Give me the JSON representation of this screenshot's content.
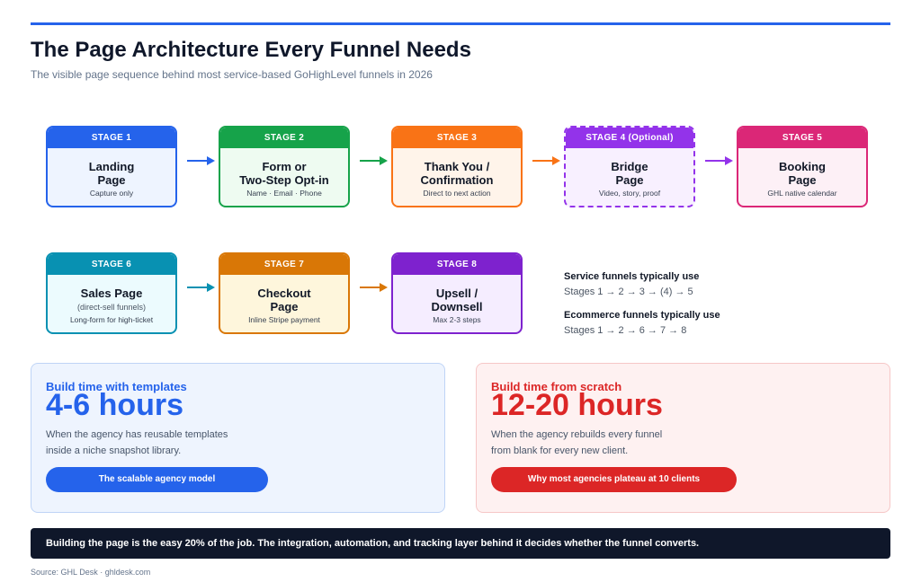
{
  "header": {
    "title": "The Page Architecture Every Funnel Needs",
    "subtitle": "The visible page sequence behind most service-based GoHighLevel funnels in 2026"
  },
  "stages": [
    {
      "label": "STAGE 1",
      "name": "Landing\nPage",
      "sub": "",
      "desc": "Capture only",
      "color": "#2563eb",
      "bg": "#eef4ff",
      "dashed": false
    },
    {
      "label": "STAGE 2",
      "name": "Form or\nTwo-Step Opt-in",
      "sub": "",
      "desc": "Name · Email · Phone",
      "color": "#16a34a",
      "bg": "#eefbf1",
      "dashed": false
    },
    {
      "label": "STAGE 3",
      "name": "Thank You /\nConfirmation",
      "sub": "",
      "desc": "Direct to next action",
      "color": "#f97316",
      "bg": "#fff4ea",
      "dashed": false
    },
    {
      "label": "STAGE 4 (Optional)",
      "name": "Bridge\nPage",
      "sub": "",
      "desc": "Video, story, proof",
      "color": "#9333ea",
      "bg": "#f8f0ff",
      "dashed": true
    },
    {
      "label": "STAGE 5",
      "name": "Booking\nPage",
      "sub": "",
      "desc": "GHL native calendar",
      "color": "#db2777",
      "bg": "#fdf0f6",
      "dashed": false
    },
    {
      "label": "STAGE 6",
      "name": "Sales Page",
      "sub": "(direct-sell funnels)",
      "desc": "Long-form for high-ticket",
      "color": "#0891b2",
      "bg": "#ecfbfe",
      "dashed": false
    },
    {
      "label": "STAGE 7",
      "name": "Checkout\nPage",
      "sub": "",
      "desc": "Inline Stripe payment",
      "color": "#d97706",
      "bg": "#fef6dc",
      "dashed": false
    },
    {
      "label": "STAGE 8",
      "name": "Upsell /\nDownsell",
      "sub": "",
      "desc": "Max 2-3 steps",
      "color": "#7e22ce",
      "bg": "#f5edff",
      "dashed": false
    }
  ],
  "arrow_colors": [
    "#2563eb",
    "#16a34a",
    "#f97316",
    "#9333ea",
    "#0891b2",
    "#d97706"
  ],
  "notes": {
    "service_heading": "Service funnels typically use",
    "service_seq": "Stages 1 → 2 → 3 → (4) → 5",
    "ecom_heading": "Ecommerce funnels typically use",
    "ecom_seq": "Stages 1 → 2 → 6 → 7 → 8"
  },
  "panels": {
    "templates": {
      "label": "Build time with templates",
      "value": "4-6 hours",
      "text": "When the agency has reusable templates\ninside a niche snapshot library.",
      "button": "The scalable agency model",
      "accent": "#2563eb"
    },
    "scratch": {
      "label": "Build time from scratch",
      "value": "12-20 hours",
      "text": "When the agency rebuilds every funnel\nfrom blank for every new client.",
      "button": "Why most agencies plateau at 10 clients",
      "accent": "#dc2626"
    }
  },
  "footer": "Building the page is the easy 20% of the job. The integration, automation, and tracking layer behind it decides whether the funnel converts.",
  "source": "Source: GHL Desk · ghldesk.com"
}
